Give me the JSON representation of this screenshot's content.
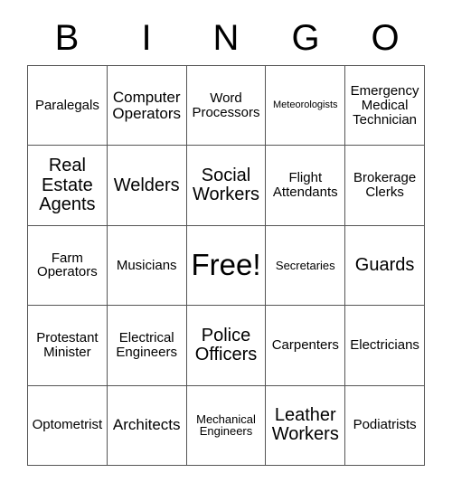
{
  "card": {
    "header": {
      "letters": [
        "B",
        "I",
        "N",
        "G",
        "O"
      ]
    },
    "grid": {
      "rows": 5,
      "columns": 5,
      "border_color": "#555555",
      "text_color": "#000000",
      "background_color": "#ffffff",
      "cells": [
        [
          {
            "label": "Paralegals",
            "size": "md",
            "free": false
          },
          {
            "label": "Computer Operators",
            "size": "lg",
            "free": false
          },
          {
            "label": "Word Processors",
            "size": "md",
            "free": false
          },
          {
            "label": "Meteorologists",
            "size": "xs",
            "free": false
          },
          {
            "label": "Emergency Medical Technician",
            "size": "md",
            "free": false
          }
        ],
        [
          {
            "label": "Real Estate Agents",
            "size": "xl",
            "free": false
          },
          {
            "label": "Welders",
            "size": "xl",
            "free": false
          },
          {
            "label": "Social Workers",
            "size": "xl",
            "free": false
          },
          {
            "label": "Flight Attendants",
            "size": "md",
            "free": false
          },
          {
            "label": "Brokerage Clerks",
            "size": "md",
            "free": false
          }
        ],
        [
          {
            "label": "Farm Operators",
            "size": "md",
            "free": false
          },
          {
            "label": "Musicians",
            "size": "md",
            "free": false
          },
          {
            "label": "Free!",
            "size": "free",
            "free": true
          },
          {
            "label": "Secretaries",
            "size": "sm",
            "free": false
          },
          {
            "label": "Guards",
            "size": "xl",
            "free": false
          }
        ],
        [
          {
            "label": "Protestant Minister",
            "size": "md",
            "free": false
          },
          {
            "label": "Electrical Engineers",
            "size": "md",
            "free": false
          },
          {
            "label": "Police Officers",
            "size": "xl",
            "free": false
          },
          {
            "label": "Carpenters",
            "size": "md",
            "free": false
          },
          {
            "label": "Electricians",
            "size": "md",
            "free": false
          }
        ],
        [
          {
            "label": "Optometrist",
            "size": "md",
            "free": false
          },
          {
            "label": "Architects",
            "size": "lg",
            "free": false
          },
          {
            "label": "Mechanical Engineers",
            "size": "sm",
            "free": false
          },
          {
            "label": "Leather Workers",
            "size": "xl",
            "free": false
          },
          {
            "label": "Podiatrists",
            "size": "md",
            "free": false
          }
        ]
      ]
    }
  }
}
